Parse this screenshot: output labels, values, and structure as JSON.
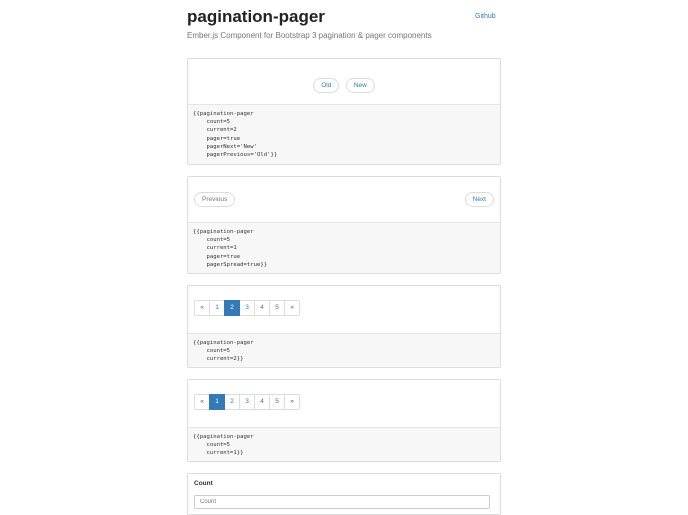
{
  "header": {
    "title": "pagination-pager",
    "subtitle": "Ember.js Component for Bootstrap 3 pagination & pager components",
    "github_link": "Github"
  },
  "demos": [
    {
      "type": "pager",
      "previous_label": "Old",
      "next_label": "New",
      "code": "{{pagination-pager\n    count=5\n    current=2\n    pager=true\n    pagerNext='New'\n    pagerPrevious='Old'}}"
    },
    {
      "type": "pager-spread",
      "previous_label": "Previous",
      "next_label": "Next",
      "code": "{{pagination-pager\n    count=5\n    current=1\n    pager=true\n    pagerSpread=true}}"
    },
    {
      "type": "pagination",
      "items": [
        "«",
        "1",
        "2",
        "3",
        "4",
        "5",
        "»"
      ],
      "current": "2",
      "code": "{{pagination-pager\n    count=5\n    current=2}}"
    },
    {
      "type": "pagination",
      "items": [
        "«",
        "1",
        "2",
        "3",
        "4",
        "5",
        "»"
      ],
      "current": "1",
      "code": "{{pagination-pager\n    count=5\n    current=1}}"
    }
  ],
  "form": {
    "count_label": "Count",
    "count_placeholder": "Count"
  },
  "colors": {
    "link": "#337ab7",
    "active_page": "#337ab7",
    "code_bg": "#f7f7f7"
  }
}
